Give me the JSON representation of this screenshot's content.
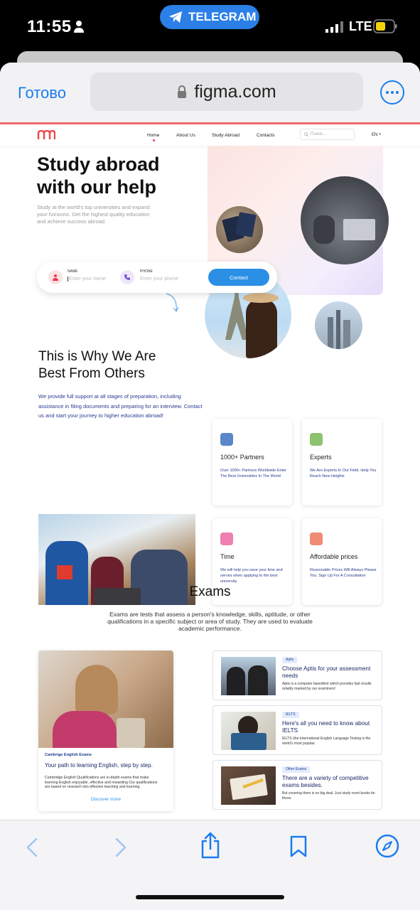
{
  "status": {
    "time": "11:55",
    "app_pill": "TELEGRAM",
    "network": "LTE"
  },
  "browser": {
    "done_label": "Готово",
    "url": "figma.com"
  },
  "site": {
    "nav": {
      "items": [
        "Home",
        "About Us",
        "Study Abroad",
        "Contacts"
      ],
      "search_placeholder": "Поиск...",
      "lang": "EN"
    },
    "hero": {
      "title_line1": "Study abroad",
      "title_line2": "with our help",
      "subtitle": "Study at the world's top universities and expand your horizons. Get the highest quality education and achieve success abroad.",
      "form": {
        "name_label": "NAME",
        "name_placeholder": "Enter your name",
        "phone_label": "PHONE",
        "phone_placeholder": "Enter your phone",
        "button": "Contact"
      }
    },
    "why": {
      "title_line1": "This is Why We Are",
      "title_line2": "Best From Others",
      "paragraph": "We provide full support at all stages of preparation, including assistance in filing documents and preparing for an interview. Contact us  and start your journey to higher education abroad!",
      "cards": [
        {
          "title": "1000+ Partners",
          "desc": "Over 1000+ Partners Worldwide Enter The Best Universities In The World",
          "color": "#5b86c9"
        },
        {
          "title": "Experts",
          "desc": "We Are Experts In Our Field. Help You Reach New Heights",
          "color": "#8cc270"
        },
        {
          "title": "Time",
          "desc": "We will help you save your time and nerves when applying to the best university.",
          "color": "#ee7fb0"
        },
        {
          "title": "Affordable prices",
          "desc": "Reasonable Prices Will Always Please You. Sign Up For A Consultation",
          "color": "#ef8c74"
        }
      ]
    },
    "exams": {
      "title": "Exams",
      "subtitle": "Exams are tests that assess a person's knowledge, skills, aptitude, or other qualifications in a specific subject or area of study. They are used to evaluate academic performance.",
      "big_card": {
        "tag": "Cambrige English Exams",
        "title": "Your path to learning English, step by step.",
        "desc": "Cambridge English Qualifications are in-depth exams that make learning English enjoyable, effective and rewarding Our qualifications are based on research into effective teaching and learning.",
        "link": "Discover more"
      },
      "items": [
        {
          "tag": "Aptis",
          "title": "Choose Aptis for your assessment needs",
          "desc": "Aptis is a computer basedtest which provides fast results reliably marked by our examiners!"
        },
        {
          "tag": "IELTS",
          "title": "Here's all you need to know about IELTS",
          "desc": "IELTS (the International English Language Testing is the world's most popular."
        },
        {
          "tag": "Other Exams",
          "title": "There are a variety of competitive exams besides.",
          "desc": "But covering them is no big deal. Just study ncert books for these."
        }
      ]
    }
  }
}
